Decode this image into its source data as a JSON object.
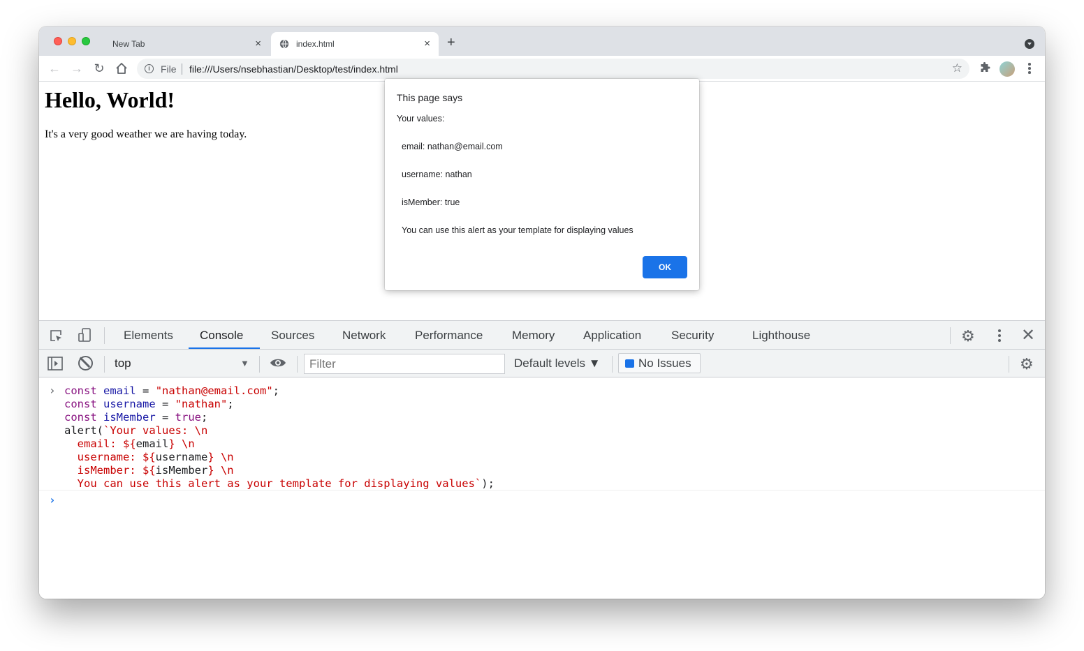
{
  "browser": {
    "tabs": [
      {
        "title": "New Tab",
        "active": false
      },
      {
        "title": "index.html",
        "active": true
      }
    ],
    "new_tab_label": "+",
    "close_label": "×",
    "omnibox": {
      "scheme_label": "File",
      "url": "file:///Users/nsebhastian/Desktop/test/index.html"
    }
  },
  "page": {
    "heading": "Hello, World!",
    "paragraph": "It's a very good weather we are having today."
  },
  "dialog": {
    "title": "This page says",
    "lines": [
      "Your values:",
      "email: nathan@email.com",
      "username: nathan",
      "isMember: true",
      "You can use this alert as your template for displaying values"
    ],
    "ok_label": "OK"
  },
  "devtools": {
    "tabs": [
      "Elements",
      "Console",
      "Sources",
      "Network",
      "Performance",
      "Memory",
      "Application",
      "Security",
      "Lighthouse"
    ],
    "active_tab": "Console",
    "console": {
      "context": "top",
      "filter_placeholder": "Filter",
      "levels_label": "Default levels ▼",
      "issues_label": "No Issues",
      "code": {
        "l1": {
          "kw": "const",
          "id": "email",
          "op": " = ",
          "val": "\"nathan@email.com\"",
          "end": ";"
        },
        "l2": {
          "kw": "const",
          "id": "username",
          "op": " = ",
          "val": "\"nathan\"",
          "end": ";"
        },
        "l3": {
          "kw": "const",
          "id": "isMember",
          "op": " = ",
          "val": "true",
          "end": ";"
        },
        "l4_a": "alert(",
        "l4_b": "`Your values: \\n",
        "l5": [
          "  email: ${",
          "email",
          "} \\n"
        ],
        "l6": [
          "  username: ${",
          "username",
          "} \\n"
        ],
        "l7": [
          "  isMember: ${",
          "isMember",
          "} \\n"
        ],
        "l8_a": "  You can use this alert as your template for displaying values`",
        "l8_b": ");"
      }
    }
  },
  "colors": {
    "accent": "#1a73e8",
    "keyword": "#881280",
    "identifier": "#1a1aa6",
    "string": "#c80000"
  },
  "icons": {
    "back": "arrow-left-icon",
    "forward": "arrow-right-icon",
    "reload": "reload-icon",
    "home": "home-icon",
    "bookmark": "star-icon",
    "extensions": "puzzle-icon"
  }
}
